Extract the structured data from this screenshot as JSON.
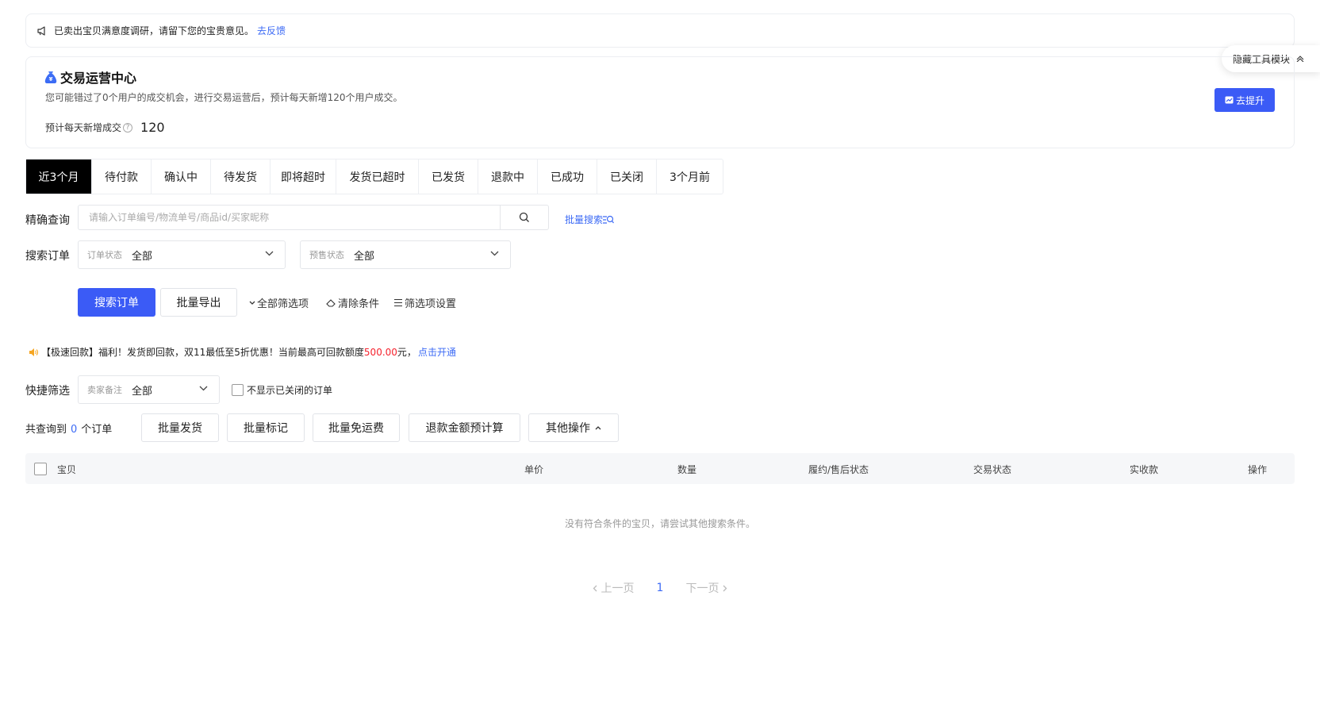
{
  "notice": {
    "text": "已卖出宝贝满意度调研，请留下您的宝贵意见。",
    "link": "去反馈"
  },
  "hide_tool": {
    "label": "隐藏工具模块"
  },
  "trade_center": {
    "title": "交易运营中心",
    "desc": "您可能错过了0个用户的成交机会，进行交易运营后，预计每天新增120个用户成交。",
    "metric_label": "预计每天新增成交",
    "metric_value": "120",
    "upgrade_label": "去提升"
  },
  "tabs": [
    "近3个月",
    "待付款",
    "确认中",
    "待发货",
    "即将超时",
    "发货已超时",
    "已发货",
    "退款中",
    "已成功",
    "已关闭",
    "3个月前"
  ],
  "precise_search": {
    "label": "精确查询",
    "placeholder": "请输入订单编号/物流单号/商品id/买家昵称",
    "batch_label": "批量搜索"
  },
  "search_order": {
    "label": "搜索订单",
    "order_status": {
      "label": "订单状态",
      "value": "全部"
    },
    "presale_status": {
      "label": "预售状态",
      "value": "全部"
    }
  },
  "actions": {
    "search": "搜索订单",
    "export": "批量导出",
    "all_filters": "全部筛选项",
    "clear": "清除条件",
    "filter_settings": "筛选项设置"
  },
  "promo": {
    "prefix": "【极速回款】福利！发货即回款，双11最低至5折优惠！当前最高可回款额度",
    "amount": "500.00",
    "suffix": "元，",
    "link": "点击开通"
  },
  "quick_filter": {
    "label": "快捷筛选",
    "seller_note": {
      "label": "卖家备注",
      "value": "全部"
    },
    "hide_closed_label": "不显示已关闭的订单"
  },
  "total": {
    "prefix": "共查询到",
    "count": "0",
    "suffix": "个订单"
  },
  "bulk_actions": {
    "ship": "批量发货",
    "mark": "批量标记",
    "free_shipping": "批量免运费",
    "refund_calc": "退款金额预计算",
    "more": "其他操作"
  },
  "table": {
    "columns": [
      "宝贝",
      "单价",
      "数量",
      "履约/售后状态",
      "交易状态",
      "实收款",
      "操作"
    ]
  },
  "empty_text": "没有符合条件的宝贝，请尝试其他搜索条件。",
  "pagination": {
    "prev": "上一页",
    "current": "1",
    "next": "下一页"
  },
  "colors": {
    "primary": "#3b5bf6",
    "link": "#3d6bf5",
    "highlight": "#f5222d"
  }
}
